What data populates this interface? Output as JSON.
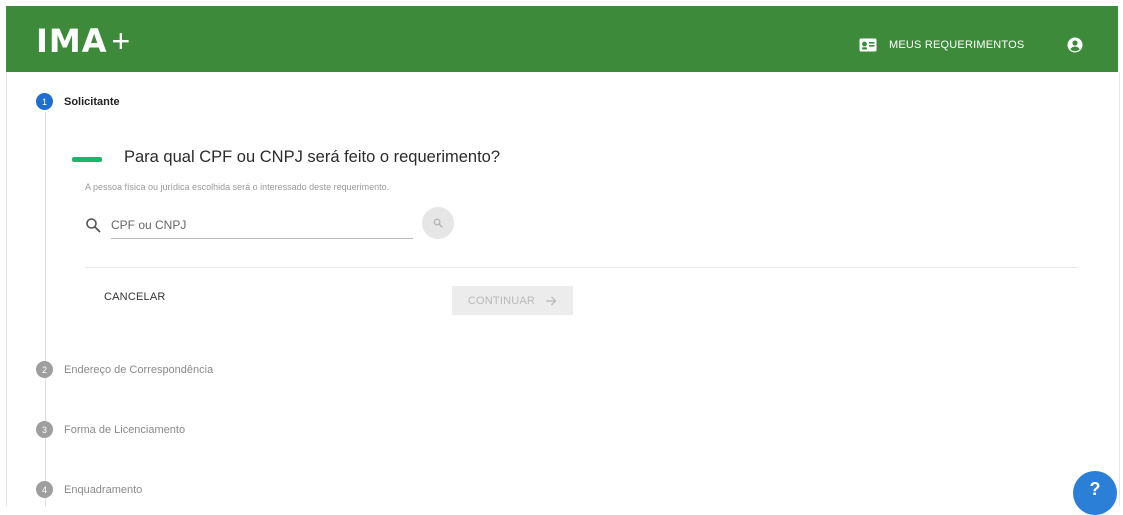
{
  "header": {
    "logo_text": "IMA",
    "logo_plus": "+",
    "requests_link": "MEUS REQUERIMENTOS",
    "requests_icon": "id-card-icon",
    "account_icon": "account-circle-icon",
    "bar_color": "#3d8b3a"
  },
  "steps": [
    {
      "number": "1",
      "label": "Solicitante",
      "state": "active"
    },
    {
      "number": "2",
      "label": "Endereço de Correspondência",
      "state": "inactive"
    },
    {
      "number": "3",
      "label": "Forma de Licenciamento",
      "state": "inactive"
    },
    {
      "number": "4",
      "label": "Enquadramento",
      "state": "inactive"
    }
  ],
  "form": {
    "question": "Para qual CPF ou CNPJ será feito o requerimento?",
    "subtitle": "A pessoa física ou jurídica escolhida será o interessado deste requerimento.",
    "search_placeholder": "CPF ou CNPJ",
    "search_value": "",
    "cancel_label": "CANCELAR",
    "continue_label": "CONTINUAR"
  },
  "help": {
    "label": "?",
    "color": "#2b7fd6"
  },
  "colors": {
    "step_active": "#1e6fce",
    "step_inactive": "#9e9e9e",
    "question_accent": "#23b26d"
  }
}
